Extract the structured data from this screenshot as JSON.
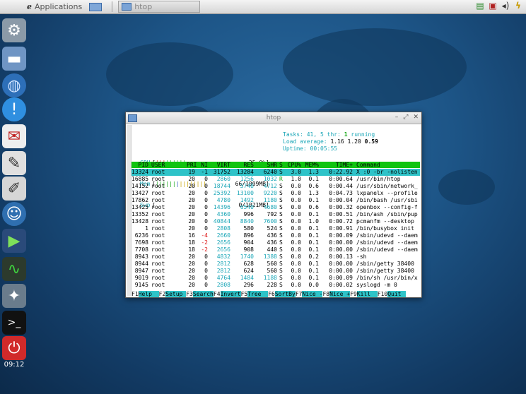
{
  "taskbar": {
    "apps_label": "Applications",
    "htop_task_label": "htop",
    "apps_icon": "e-logo-icon"
  },
  "clock": "09:12",
  "dock": [
    "settings-icon",
    "file-manager-icon",
    "network-icon",
    "info-icon",
    "mail-icon",
    "text-editor-icon",
    "notepad-icon",
    "support-icon",
    "media-player-icon",
    "system-monitor-icon",
    "tools-icon",
    "terminal-icon",
    "power-icon"
  ],
  "window": {
    "title": "htop",
    "cpu_label": "CPU",
    "cpu_value": "25.0%",
    "mem_label": "Mem",
    "mem_value": "66/1009MB",
    "swp_label": "Swp",
    "swp_value": "0/1021MB",
    "tasks_label": "Tasks:",
    "tasks_value": "41,",
    "thr_value": "5",
    "thr_label": "thr:",
    "running_value": "1",
    "running_label": "running",
    "load_label": "Load average:",
    "load1": "1.16",
    "load5": "1.20",
    "load15": "0.59",
    "uptime_label": "Uptime:",
    "uptime_value": "00:05:55",
    "columns": [
      "PID",
      "USER",
      "PRI",
      "NI",
      "VIRT",
      "RES",
      "SHR",
      "S",
      "CPU%",
      "MEM%",
      "TIME+",
      "Command"
    ],
    "rows": [
      [
        "13324",
        "root",
        "19",
        "-1",
        "31752",
        "13284",
        "6240",
        "S",
        "3.0",
        "1.3",
        "0:22.92",
        "X :0 -br -nolisten"
      ],
      [
        "16885",
        "root",
        "20",
        "0",
        "2860",
        "1256",
        "1032",
        "R",
        "1.0",
        "0.1",
        "0:00.64",
        "/usr/bin/htop"
      ],
      [
        "14152",
        "root",
        "20",
        "0",
        "18744",
        "5748",
        "4712",
        "S",
        "0.0",
        "0.6",
        "0:00.44",
        "/usr/sbin/network_"
      ],
      [
        "13427",
        "root",
        "20",
        "0",
        "25392",
        "13100",
        "9220",
        "S",
        "0.0",
        "1.3",
        "0:04.73",
        "lxpanelx --profile"
      ],
      [
        "17862",
        "root",
        "20",
        "0",
        "4780",
        "1492",
        "1180",
        "S",
        "0.0",
        "0.1",
        "0:00.04",
        "/bin/bash /usr/sbi"
      ],
      [
        "13425",
        "root",
        "20",
        "0",
        "14396",
        "6540",
        "4680",
        "S",
        "0.0",
        "0.6",
        "0:00.32",
        "openbox --config-f"
      ],
      [
        "13352",
        "root",
        "20",
        "0",
        "4360",
        "996",
        "792",
        "S",
        "0.0",
        "0.1",
        "0:00.51",
        "/bin/ash /sbin/pup"
      ],
      [
        "13428",
        "root",
        "20",
        "0",
        "40844",
        "8840",
        "7600",
        "S",
        "0.0",
        "1.0",
        "0:00.72",
        "pcmanfm --desktop"
      ],
      [
        "1",
        "root",
        "20",
        "0",
        "2808",
        "580",
        "524",
        "S",
        "0.0",
        "0.1",
        "0:00.91",
        "/bin/busybox init"
      ],
      [
        "6236",
        "root",
        "16",
        "-4",
        "2660",
        "896",
        "436",
        "S",
        "0.0",
        "0.1",
        "0:00.09",
        "/sbin/udevd --daem"
      ],
      [
        "7698",
        "root",
        "18",
        "-2",
        "2656",
        "904",
        "436",
        "S",
        "0.0",
        "0.1",
        "0:00.00",
        "/sbin/udevd --daem"
      ],
      [
        "7708",
        "root",
        "18",
        "-2",
        "2656",
        "908",
        "440",
        "S",
        "0.0",
        "0.1",
        "0:00.00",
        "/sbin/udevd --daem"
      ],
      [
        "8943",
        "root",
        "20",
        "0",
        "4832",
        "1740",
        "1388",
        "S",
        "0.0",
        "0.2",
        "0:00.13",
        "-sh"
      ],
      [
        "8944",
        "root",
        "20",
        "0",
        "2812",
        "628",
        "560",
        "S",
        "0.0",
        "0.1",
        "0:00.00",
        "/sbin/getty 38400"
      ],
      [
        "8947",
        "root",
        "20",
        "0",
        "2812",
        "624",
        "560",
        "S",
        "0.0",
        "0.1",
        "0:00.00",
        "/sbin/getty 38400"
      ],
      [
        "9019",
        "root",
        "20",
        "0",
        "4764",
        "1484",
        "1188",
        "S",
        "0.0",
        "0.1",
        "0:00.09",
        "/bin/sh /usr/bin/x"
      ],
      [
        "9145",
        "root",
        "20",
        "0",
        "2808",
        "296",
        "228",
        "S",
        "0.0",
        "0.0",
        "0:00.02",
        "syslogd -m 0"
      ]
    ],
    "fkeys": [
      {
        "key": "F1",
        "label": "Help"
      },
      {
        "key": "F2",
        "label": "Setup"
      },
      {
        "key": "F3",
        "label": "Search"
      },
      {
        "key": "F4",
        "label": "Invert"
      },
      {
        "key": "F5",
        "label": "Tree"
      },
      {
        "key": "F6",
        "label": "SortBy"
      },
      {
        "key": "F7",
        "label": "Nice -"
      },
      {
        "key": "F8",
        "label": "Nice +"
      },
      {
        "key": "F9",
        "label": "Kill"
      },
      {
        "key": "F10",
        "label": "Quit"
      }
    ]
  }
}
